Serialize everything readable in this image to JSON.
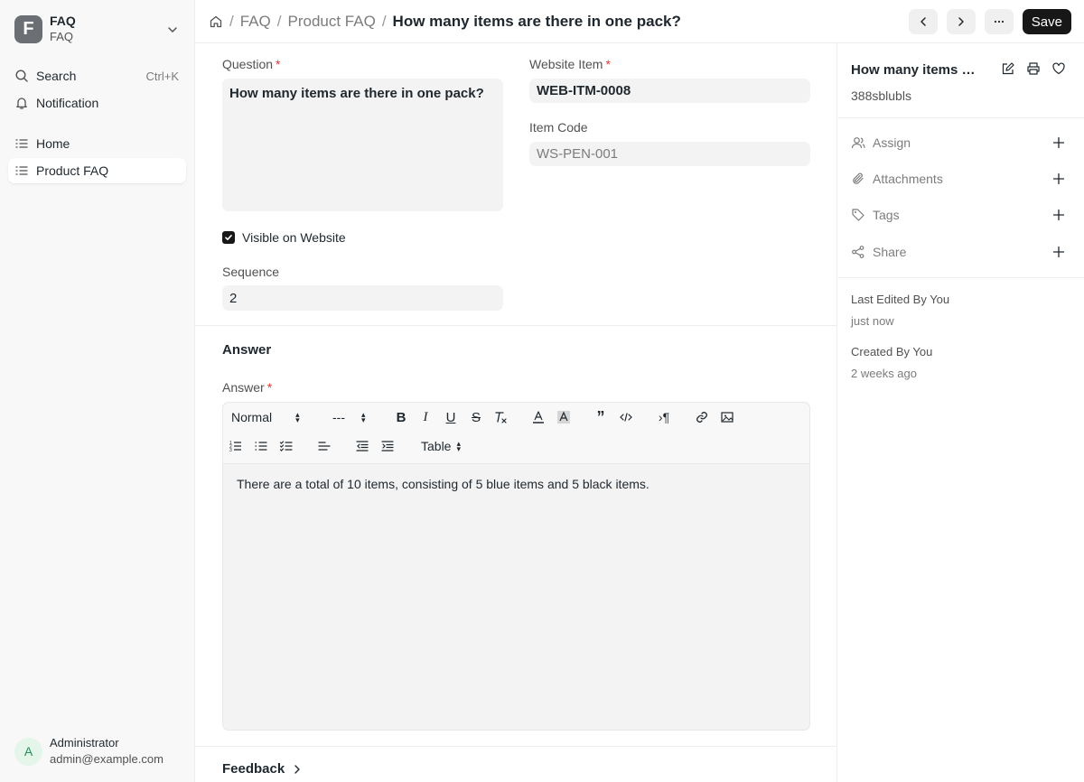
{
  "app": {
    "logo_letter": "F",
    "name": "FAQ",
    "sub": "FAQ"
  },
  "sidebar": {
    "search_label": "Search",
    "search_shortcut": "Ctrl+K",
    "notification_label": "Notification",
    "items": [
      {
        "label": "Home",
        "active": false
      },
      {
        "label": "Product FAQ",
        "active": true
      }
    ]
  },
  "user": {
    "initial": "A",
    "name": "Administrator",
    "email": "admin@example.com"
  },
  "breadcrumb": {
    "items": [
      "FAQ",
      "Product FAQ"
    ],
    "current": "How many items are there in one pack?"
  },
  "toolbar": {
    "save_label": "Save"
  },
  "form": {
    "question_label": "Question",
    "question_value": "How many items are there in one pack?",
    "website_item_label": "Website Item",
    "website_item_value": "WEB-ITM-0008",
    "item_code_label": "Item Code",
    "item_code_value": "WS-PEN-001",
    "visible_label": "Visible on Website",
    "visible_checked": true,
    "sequence_label": "Sequence",
    "sequence_value": "2",
    "answer_section": "Answer",
    "answer_label": "Answer",
    "answer_value": "There are a total of 10 items, consisting of 5 blue items and 5 black items.",
    "required_marker": "*",
    "feedback_label": "Feedback"
  },
  "editor_toolbar": {
    "style_select": "Normal",
    "size_select": "---",
    "table_select": "Table"
  },
  "right_panel": {
    "title": "How many items are there in one pack?",
    "doc_id": "388sblubls",
    "actions": [
      {
        "label": "Assign",
        "icon": "user-icon"
      },
      {
        "label": "Attachments",
        "icon": "paperclip-icon"
      },
      {
        "label": "Tags",
        "icon": "tag-icon"
      },
      {
        "label": "Share",
        "icon": "share-icon"
      }
    ],
    "last_edited": "Last Edited By You",
    "last_edited_time": "just now",
    "created": "Created By You",
    "created_time": "2 weeks ago"
  },
  "colors": {
    "accent": "#171717",
    "required": "#e03636",
    "field_bg": "#f3f3f3"
  }
}
